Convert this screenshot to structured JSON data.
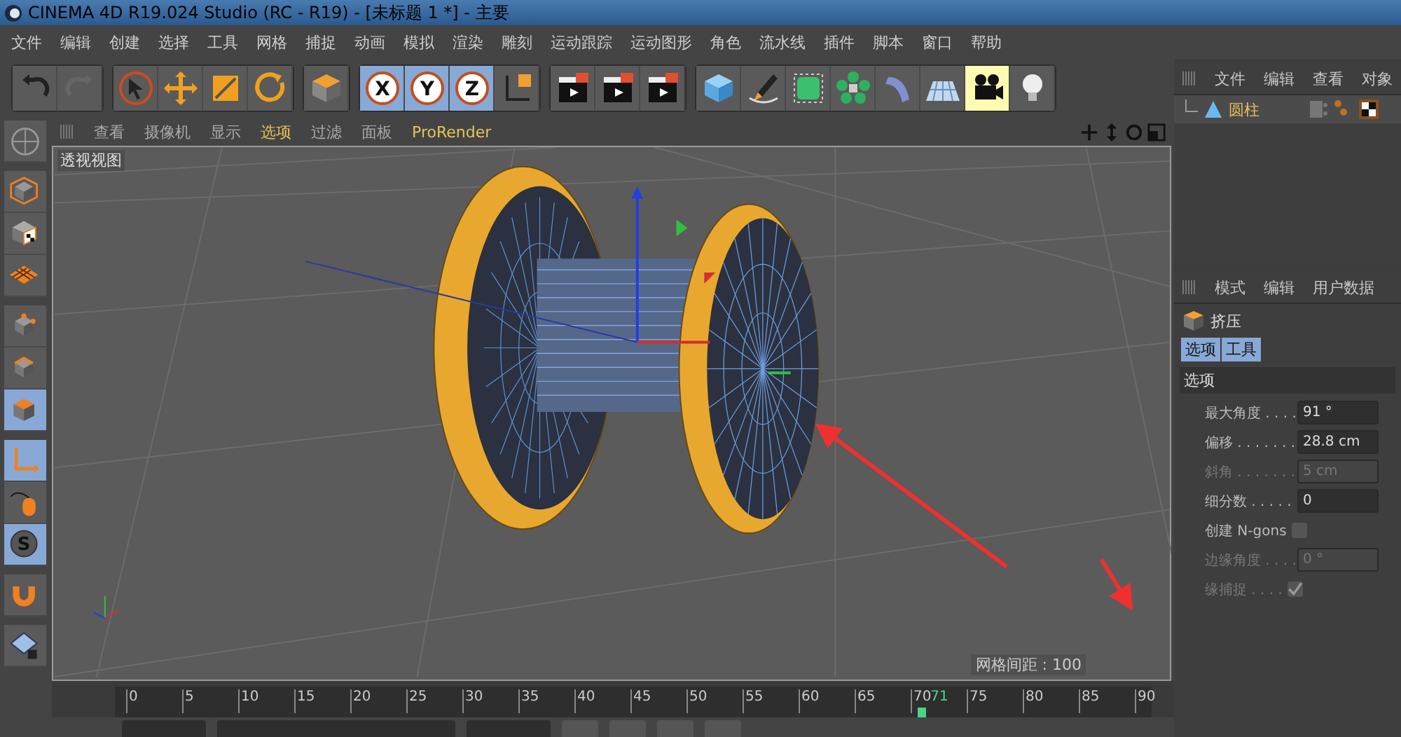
{
  "window": {
    "title": "CINEMA 4D R19.024 Studio (RC - R19) - [未标题 1 *] - 主要"
  },
  "menu": [
    "文件",
    "编辑",
    "创建",
    "选择",
    "工具",
    "网格",
    "捕捉",
    "动画",
    "模拟",
    "渲染",
    "雕刻",
    "运动跟踪",
    "运动图形",
    "角色",
    "流水线",
    "插件",
    "脚本",
    "窗口",
    "帮助"
  ],
  "toolbar": [
    [
      {
        "kind": "undo",
        "selected": false
      },
      {
        "kind": "redo",
        "selected": false
      }
    ],
    [
      {
        "kind": "select",
        "selected": false
      },
      {
        "kind": "move",
        "selected": false
      },
      {
        "kind": "scale",
        "selected": false
      },
      {
        "kind": "rotate",
        "selected": false
      }
    ],
    [
      {
        "kind": "cube-orange",
        "selected": false
      }
    ],
    [
      {
        "kind": "x",
        "label": "X",
        "selected": true
      },
      {
        "kind": "y",
        "label": "Y",
        "selected": true
      },
      {
        "kind": "z",
        "label": "Z",
        "selected": true
      },
      {
        "kind": "coords",
        "selected": false
      }
    ],
    [
      {
        "kind": "clapper",
        "selected": false
      },
      {
        "kind": "clapper",
        "selected": false
      },
      {
        "kind": "clapper",
        "selected": false
      }
    ],
    [
      {
        "kind": "cube-blue",
        "selected": false
      },
      {
        "kind": "pen",
        "selected": false
      },
      {
        "kind": "cube-green",
        "selected": false
      },
      {
        "kind": "flower",
        "selected": false
      },
      {
        "kind": "bend",
        "selected": false
      },
      {
        "kind": "floor",
        "selected": false
      },
      {
        "kind": "camera",
        "selected": true
      },
      {
        "kind": "bulb",
        "selected": false
      }
    ]
  ],
  "tools": [
    [
      {
        "kind": "model",
        "selected": false
      },
      {
        "kind": "texture",
        "selected": false
      },
      {
        "kind": "workplane",
        "selected": false
      }
    ],
    [
      {
        "kind": "points",
        "selected": false
      },
      {
        "kind": "edges",
        "selected": false
      },
      {
        "kind": "polygons",
        "selected": true
      }
    ],
    [
      {
        "kind": "axis",
        "selected": true
      },
      {
        "kind": "mouse",
        "selected": false
      },
      {
        "kind": "snap",
        "label": "S",
        "selected": true
      }
    ],
    [
      {
        "kind": "magnet",
        "selected": false
      }
    ],
    [
      {
        "kind": "grid",
        "selected": false
      }
    ]
  ],
  "viewport": {
    "menu": [
      {
        "label": "查看",
        "accent": false
      },
      {
        "label": "摄像机",
        "accent": false
      },
      {
        "label": "显示",
        "accent": false
      },
      {
        "label": "选项",
        "accent": true
      },
      {
        "label": "过滤",
        "accent": false
      },
      {
        "label": "面板",
        "accent": false
      },
      {
        "label": "ProRender",
        "accent": true
      }
    ],
    "label": "透视视图",
    "grid_note": "网格间距 : 100"
  },
  "timeline": {
    "ticks": [
      "0",
      "5",
      "10",
      "15",
      "20",
      "25",
      "30",
      "35",
      "40",
      "45",
      "50",
      "55",
      "60",
      "65",
      "70",
      "75",
      "80",
      "85",
      "90"
    ],
    "current": "71",
    "level": 0.789
  },
  "objects": {
    "menu": [
      "文件",
      "编辑",
      "查看",
      "对象"
    ],
    "items": [
      {
        "name": "圆柱",
        "selected": true
      }
    ]
  },
  "attributes": {
    "menu": [
      "模式",
      "编辑",
      "用户数据"
    ],
    "title": "挤压",
    "tabs": [
      {
        "label": "选项",
        "selected": true
      },
      {
        "label": "工具",
        "selected": true
      }
    ],
    "section": "选项",
    "fields": [
      {
        "kind": "number",
        "label": "最大角度",
        "dots": ". . . .",
        "value": "91 °",
        "disabled": false
      },
      {
        "kind": "number",
        "label": "偏移",
        "dots": ". . . . . . .",
        "value": "28.8 cm",
        "disabled": false
      },
      {
        "kind": "number",
        "label": "斜角",
        "dots": ". . . . . . .",
        "value": "5 cm",
        "disabled": true
      },
      {
        "kind": "number",
        "label": "细分数",
        "dots": ". . . . .",
        "value": "0",
        "disabled": false
      },
      {
        "kind": "checkbox",
        "label": "创建 N-gons",
        "checked": false,
        "disabled": false
      },
      {
        "kind": "number",
        "label": "边缘角度",
        "dots": ". . . .",
        "value": "0 °",
        "disabled": true
      },
      {
        "kind": "checkbox",
        "label": "缘捕捉",
        "dots": ". . . .",
        "checked": true,
        "disabled": true
      }
    ]
  }
}
